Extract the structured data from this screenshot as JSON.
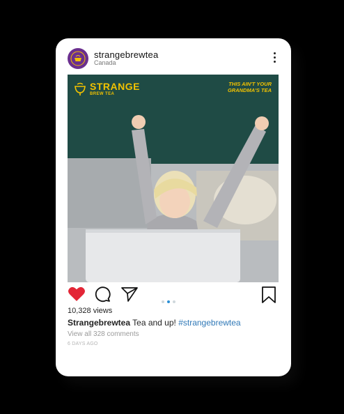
{
  "post": {
    "username": "strangebrewtea",
    "location": "Canada",
    "brand_name": "STRANGE",
    "brand_sub": "BREW TEA",
    "tagline_line1": "THIS AIN'T YOUR",
    "tagline_line2": "GRANDMA'S TEA",
    "views": "10,328 views",
    "caption_user": "Strangebrewtea",
    "caption_text": " Tea and up! ",
    "caption_hashtag": "#strangebrewtea",
    "comments_link": "View all 328 comments",
    "timestamp": "6 DAYS AGO",
    "carousel": {
      "count": 3,
      "active_index": 1
    }
  },
  "icons": [
    "more-vertical-icon",
    "heart-icon",
    "comment-icon",
    "share-icon",
    "bookmark-icon"
  ],
  "colors": {
    "liked_heart": "#e32636",
    "carousel_active": "#2b8fd6",
    "hashtag": "#2f78b7",
    "avatar_bg": "#6b2f8f",
    "brand_yellow": "#f2c200"
  }
}
